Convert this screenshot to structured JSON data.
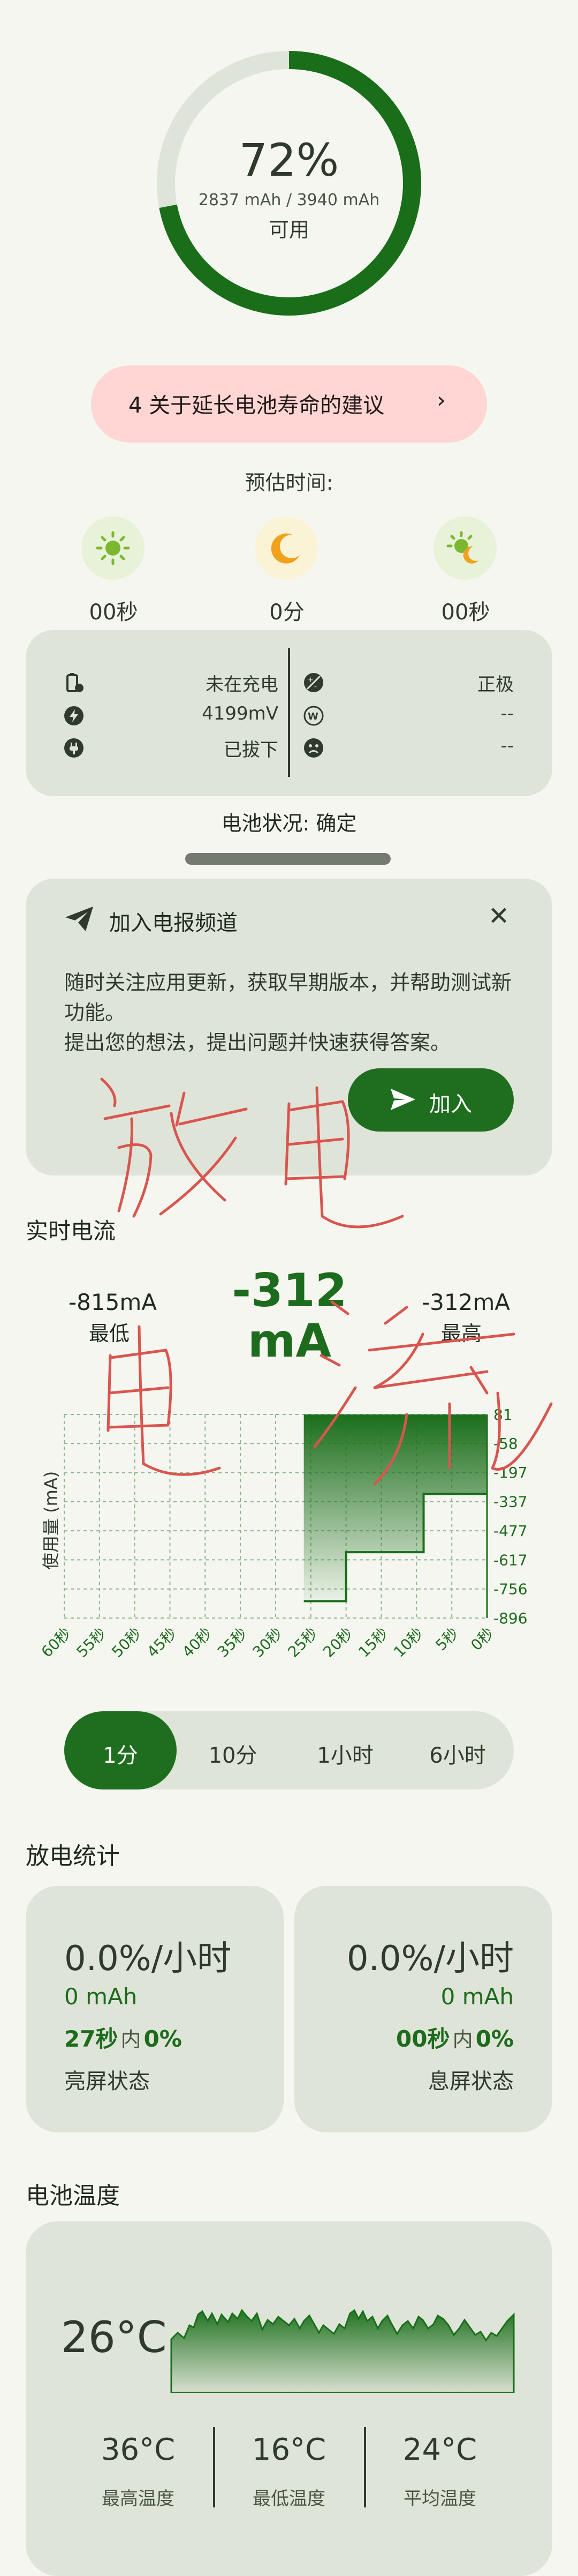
{
  "battery": {
    "percent": "72%",
    "capacity": "2837 mAh / 3940 mAh",
    "status": "可用",
    "level_fraction": 0.72,
    "ring_color": "#1a6e1a"
  },
  "tips": {
    "label": "4 关于延长电池寿命的建议",
    "chevron": "›"
  },
  "estimate": {
    "title": "预估时间:",
    "items": [
      {
        "icon": "sun-icon",
        "value": "00秒"
      },
      {
        "icon": "moon-icon",
        "value": "0分"
      },
      {
        "icon": "sun-moon-icon",
        "value": "00秒"
      }
    ]
  },
  "info": {
    "left": [
      {
        "icon": "battery-charge-icon",
        "value": "未在充电"
      },
      {
        "icon": "bolt-icon",
        "value": "4199mV"
      },
      {
        "icon": "plug-icon",
        "value": "已拔下"
      }
    ],
    "right": [
      {
        "icon": "polarity-icon",
        "value": "正极"
      },
      {
        "icon": "watt-icon",
        "value": "--"
      },
      {
        "icon": "face-icon",
        "value": "--"
      }
    ]
  },
  "health": "电池状况: 确定",
  "telegram": {
    "title": "加入电报频道",
    "body": "随时关注应用更新，获取早期版本，并帮助测试新功能。\n提出您的想法，提出问题并快速获得答案。",
    "join": "加入"
  },
  "realtime": {
    "title": "实时电流",
    "min_value": "-815mA",
    "min_label": "最低",
    "current": "-312mA",
    "max_value": "-312mA",
    "max_label": "最高"
  },
  "chart_data": {
    "type": "area",
    "ylabel": "使用量 (mA)",
    "x_ticks": [
      "60秒",
      "55秒",
      "50秒",
      "45秒",
      "40秒",
      "35秒",
      "30秒",
      "25秒",
      "20秒",
      "15秒",
      "10秒",
      "5秒",
      "0秒"
    ],
    "y_ticks": [
      81,
      -58,
      -197,
      -337,
      -477,
      -617,
      -756,
      -896
    ],
    "ylim": [
      -896,
      81
    ],
    "grid": true,
    "series": [
      {
        "x": [
          26,
          20,
          20,
          9,
          9,
          0
        ],
        "y": [
          -815,
          -815,
          -580,
          -580,
          -300,
          -300
        ]
      }
    ],
    "line_color": "#1a6e1a"
  },
  "ranges": {
    "options": [
      "1分",
      "10分",
      "1小时",
      "6小时"
    ],
    "selected": "1分"
  },
  "discharge": {
    "title": "放电统计",
    "cards": [
      {
        "rate": "0.0%/小时",
        "mah": "0 mAh",
        "time": "27秒",
        "in": "内",
        "pct": "0%",
        "label": "亮屏状态"
      },
      {
        "rate": "0.0%/小时",
        "mah": "0 mAh",
        "time": "00秒",
        "in": "内",
        "pct": "0%",
        "label": "息屏状态"
      }
    ]
  },
  "temperature": {
    "title": "电池温度",
    "current": "26°C",
    "stats": [
      {
        "value": "36°C",
        "label": "最高温度"
      },
      {
        "value": "16°C",
        "label": "最低温度"
      },
      {
        "value": "24°C",
        "label": "平均温度"
      }
    ]
  },
  "handwriting": {
    "text": "放电 电流",
    "color": "#d9554f"
  }
}
